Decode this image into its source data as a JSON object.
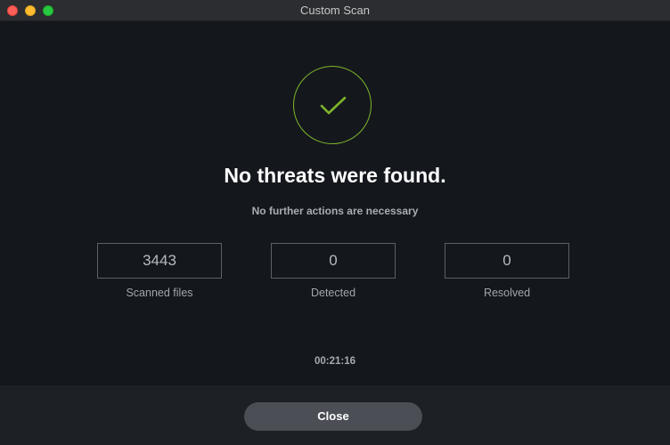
{
  "window": {
    "title": "Custom Scan"
  },
  "result": {
    "icon": "checkmark-icon",
    "headline": "No threats were found.",
    "subline": "No further actions are necessary"
  },
  "stats": [
    {
      "value": "3443",
      "label": "Scanned files"
    },
    {
      "value": "0",
      "label": "Detected"
    },
    {
      "value": "0",
      "label": "Resolved"
    }
  ],
  "elapsed_time": "00:21:16",
  "footer": {
    "close_label": "Close"
  },
  "colors": {
    "accent_green": "#7fb52a",
    "background": "#14181d",
    "button": "#4b4f55"
  }
}
